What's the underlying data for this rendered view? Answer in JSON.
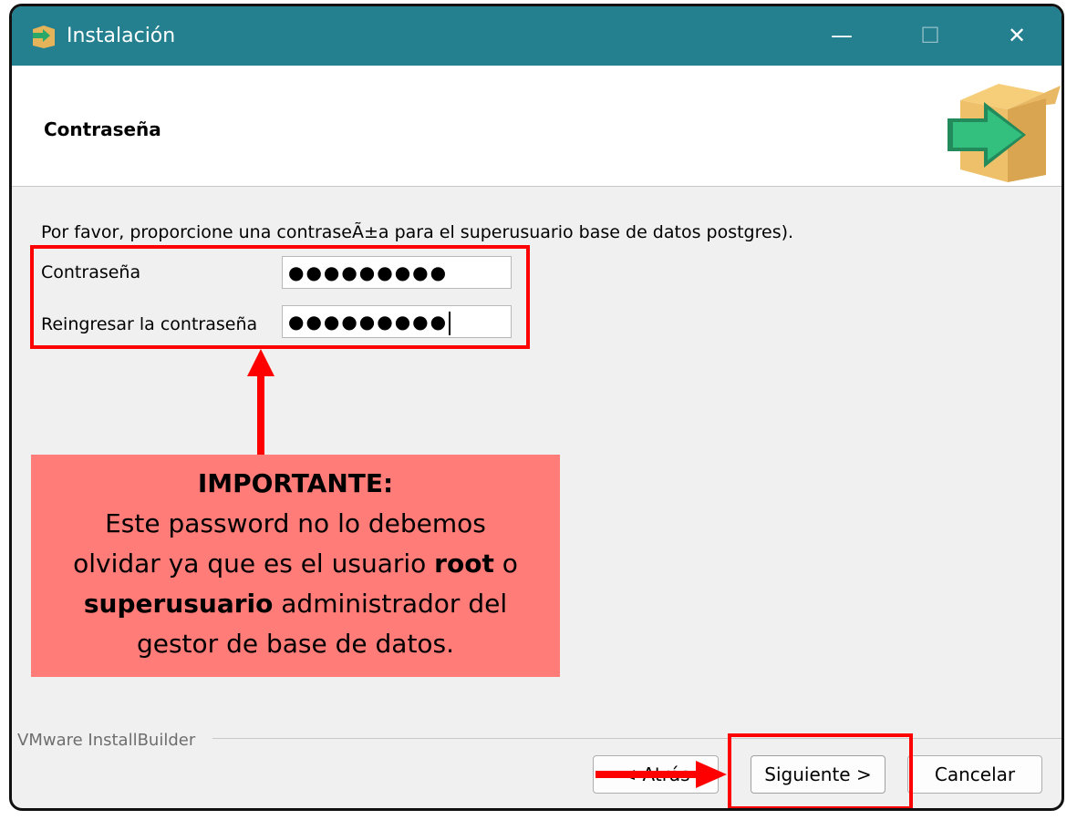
{
  "window": {
    "title": "Instalación",
    "icon": "installer-box-icon"
  },
  "titlebar": {
    "minimize": "—",
    "maximize": "☐",
    "close": "✕"
  },
  "header": {
    "title": "Contraseña",
    "logo": "installer-box-arrow-icon"
  },
  "intro": "Por favor, proporcione una contraseÃ±a para el superusuario base de datos postgres).",
  "fields": [
    {
      "label": "Contraseña",
      "value": "●●●●●●●●●"
    },
    {
      "label": "Reingresar la contraseña",
      "value": "●●●●●●●●●"
    }
  ],
  "callout": {
    "heading": "IMPORTANTE:",
    "line1": "Este password no lo debemos",
    "line2_pre": "olvidar ya que es el usuario ",
    "line2_bold": "root",
    "line2_post": " o",
    "line3_bold": "superusuario",
    "line3_post": " administrador del",
    "line4": "gestor de base de datos."
  },
  "footer": {
    "brand": "VMware InstallBuilder",
    "back": "< Atrás",
    "next": "Siguiente >",
    "cancel": "Cancelar"
  },
  "colors": {
    "titlebar": "#24808f",
    "highlight": "#ff0000",
    "callout": "#ff7c79"
  }
}
